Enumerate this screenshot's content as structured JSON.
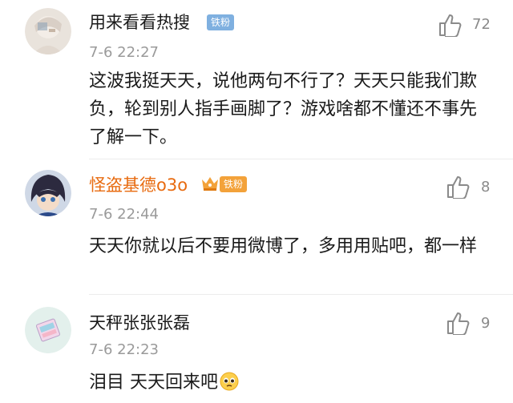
{
  "comments": [
    {
      "username": "用来看看热搜",
      "badge": "铁粉",
      "time": "7-6 22:27",
      "text": "这波我挺天天，说他两句不行了？天天只能我们欺负，轮到别人指手画脚了？游戏啥都不懂还不事先了解一下。",
      "likes": "72",
      "name_color": "#1a1a1a"
    },
    {
      "username": "怪盗基德o3o",
      "badge": "铁粉",
      "time": "7-6 22:44",
      "text": "天天你就以后不要用微博了，多用用贴吧，都一样",
      "likes": "8",
      "name_color": "#e86b10"
    },
    {
      "username": "天秤张张张磊",
      "time": "7-6 22:23",
      "text": "泪目 天天回来吧",
      "emoji": "pleading-face-emoji",
      "likes": "9",
      "name_color": "#1a1a1a"
    }
  ],
  "colors": {
    "badge_bg": "#7fb0e0",
    "vip_badge_bg": "#f3a23a",
    "time": "#9a9a9a",
    "like": "#8a8a8a"
  }
}
